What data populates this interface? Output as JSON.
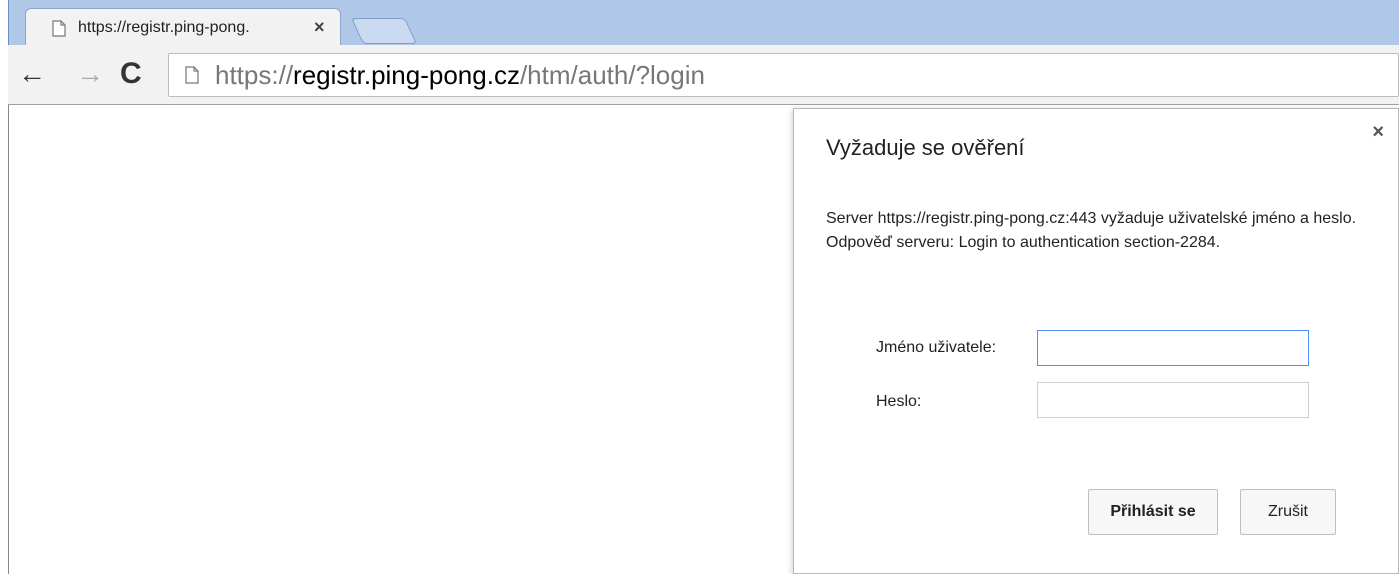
{
  "tab": {
    "title": "https://registr.ping-pong.",
    "close": "×"
  },
  "toolbar": {
    "back_icon": "←",
    "forward_icon": "→",
    "reload_icon": "C",
    "url_scheme": "https://",
    "url_host": "registr.ping-pong.cz",
    "url_path": "/htm/auth/?login"
  },
  "dialog": {
    "close": "×",
    "title": "Vyžaduje se ověření",
    "message": "Server https://registr.ping-pong.cz:443 vyžaduje uživatelské jméno a heslo. Odpověď serveru: Login to authentication section-2284.",
    "username_label": "Jméno uživatele:",
    "username_value": "",
    "password_label": "Heslo:",
    "password_value": "",
    "login_button": "Přihlásit se",
    "cancel_button": "Zrušit"
  },
  "colors": {
    "tabstrip": "#b0c8e8",
    "focus_border": "#4d90fe"
  },
  "icons": [
    "page-icon",
    "close-icon",
    "back-arrow-icon",
    "forward-arrow-icon",
    "reload-icon"
  ]
}
